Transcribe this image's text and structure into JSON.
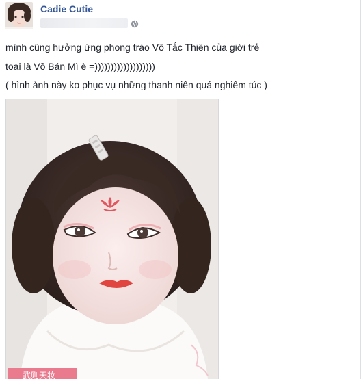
{
  "post": {
    "author": "Cadie Cutie",
    "lines": [
      "mình cũng hưởng ứng phong trào Võ Tắc Thiên của giới trẻ",
      "toai là Võ Bán Mì è =)))))))))))))))))))",
      "( hình ảnh này ko phục vụ những thanh niên quá nghiêm túc )"
    ],
    "photo_watermark": "武则天妆"
  },
  "icons": {
    "privacy": "globe-icon"
  },
  "colors": {
    "author": "#365899",
    "text": "#1d2129",
    "watermark": "#ea7a8e"
  }
}
